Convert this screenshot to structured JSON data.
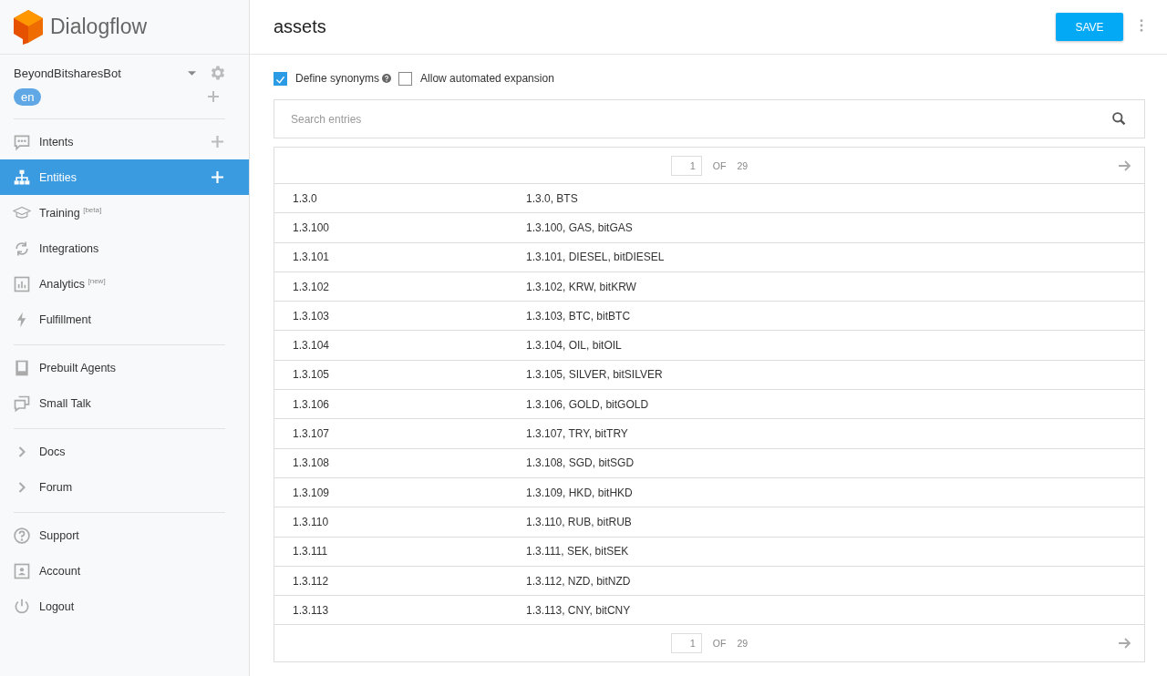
{
  "logo": {
    "text": "Dialogflow"
  },
  "agent": {
    "name": "BeyondBitsharesBot",
    "language": "en"
  },
  "sidebar": {
    "groups": [
      {
        "items": [
          {
            "kind": "intents",
            "label": "Intents",
            "selected": false,
            "addable": true
          },
          {
            "kind": "entities",
            "label": "Entities",
            "selected": true,
            "addable": true
          },
          {
            "kind": "training",
            "label": "Training $^{[beta]}$",
            "selected": false,
            "addable": false
          },
          {
            "kind": "integrations",
            "label": "Integrations",
            "selected": false,
            "addable": false
          },
          {
            "kind": "analytics",
            "label": "Analytics $^{[new]}$",
            "selected": false,
            "addable": false
          },
          {
            "kind": "fulfillment",
            "label": "Fulfillment",
            "selected": false,
            "addable": false
          }
        ]
      },
      {
        "items": [
          {
            "kind": "prebuilt",
            "label": "Prebuilt Agents",
            "selected": false,
            "addable": false
          },
          {
            "kind": "smalltalk",
            "label": "Small Talk",
            "selected": false,
            "addable": false
          }
        ]
      },
      {
        "items": [
          {
            "kind": "chevron",
            "label": "Docs",
            "selected": false,
            "addable": false
          },
          {
            "kind": "chevron",
            "label": "Forum",
            "selected": false,
            "addable": false
          }
        ]
      },
      {
        "items": [
          {
            "kind": "support",
            "label": "Support",
            "selected": false,
            "addable": false
          },
          {
            "kind": "account",
            "label": "Account",
            "selected": false,
            "addable": false
          },
          {
            "kind": "logout",
            "label": "Logout",
            "selected": false,
            "addable": false
          }
        ]
      }
    ]
  },
  "page": {
    "title": "assets",
    "save_button": "SAVE"
  },
  "options": [
    {
      "label": "Define synonyms",
      "checked": true,
      "help": true
    },
    {
      "label": "Allow automated expansion",
      "checked": false,
      "help": false
    }
  ],
  "search": {
    "placeholder": "Search entries"
  },
  "pager_top": {
    "page": "1",
    "of": "OF",
    "total": "29"
  },
  "rows": [
    {
      "value": "1.3.0",
      "synonyms": "1.3.0, BTS"
    },
    {
      "value": "1.3.100",
      "synonyms": "1.3.100, GAS, bitGAS"
    },
    {
      "value": "1.3.101",
      "synonyms": "1.3.101, DIESEL, bitDIESEL"
    },
    {
      "value": "1.3.102",
      "synonyms": "1.3.102, KRW, bitKRW"
    },
    {
      "value": "1.3.103",
      "synonyms": "1.3.103, BTC, bitBTC"
    },
    {
      "value": "1.3.104",
      "synonyms": "1.3.104, OIL, bitOIL"
    },
    {
      "value": "1.3.105",
      "synonyms": "1.3.105, SILVER, bitSILVER"
    },
    {
      "value": "1.3.106",
      "synonyms": "1.3.106, GOLD, bitGOLD"
    },
    {
      "value": "1.3.107",
      "synonyms": "1.3.107, TRY, bitTRY"
    },
    {
      "value": "1.3.108",
      "synonyms": "1.3.108, SGD, bitSGD"
    },
    {
      "value": "1.3.109",
      "synonyms": "1.3.109, HKD, bitHKD"
    },
    {
      "value": "1.3.110",
      "synonyms": "1.3.110, RUB, bitRUB"
    },
    {
      "value": "1.3.111",
      "synonyms": "1.3.111, SEK, bitSEK"
    },
    {
      "value": "1.3.112",
      "synonyms": "1.3.112, NZD, bitNZD"
    },
    {
      "value": "1.3.113",
      "synonyms": "1.3.113, CNY, bitCNY"
    }
  ],
  "pager_bottom": {
    "page": "1",
    "of": "OF",
    "total": "29"
  }
}
